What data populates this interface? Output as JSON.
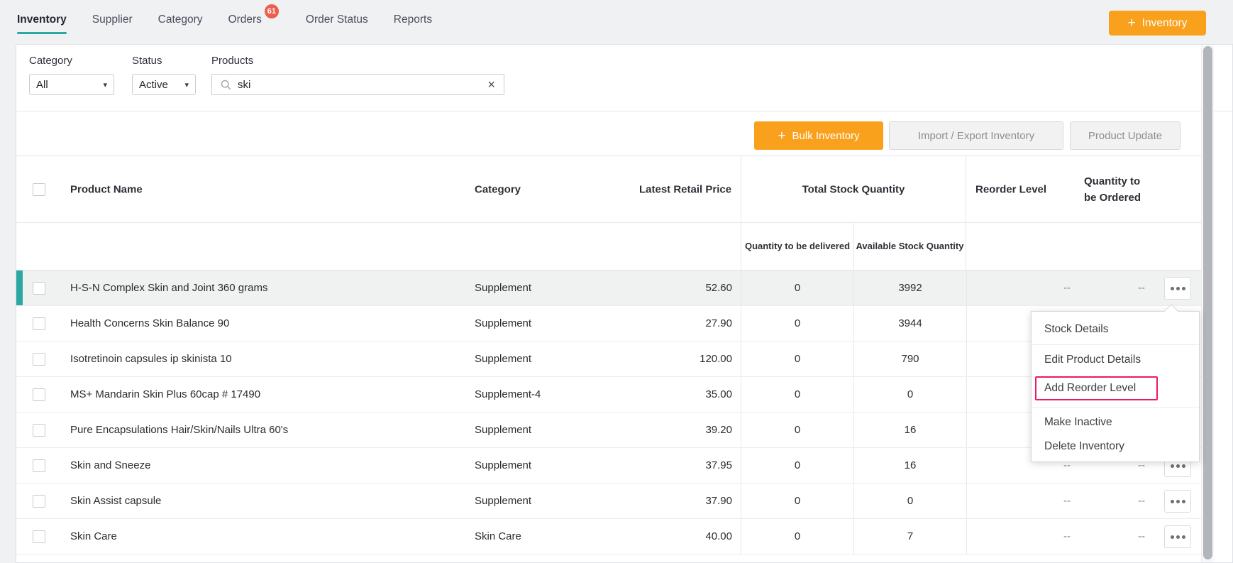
{
  "nav": {
    "tabs": [
      {
        "label": "Inventory",
        "active": true
      },
      {
        "label": "Supplier"
      },
      {
        "label": "Category"
      },
      {
        "label": "Orders",
        "badge": "61"
      },
      {
        "label": "Order Status"
      },
      {
        "label": "Reports"
      }
    ],
    "add_button": {
      "icon": "+",
      "label": "Inventory"
    }
  },
  "filters": {
    "category": {
      "label": "Category",
      "value": "All"
    },
    "status": {
      "label": "Status",
      "value": "Active"
    },
    "products": {
      "label": "Products",
      "value": "ski"
    },
    "clear_icon": "×"
  },
  "toolbar": {
    "bulk_button": {
      "icon": "+",
      "label": "Bulk Inventory"
    },
    "import_export_label": "Import / Export Inventory",
    "product_update_label": "Product Update"
  },
  "table": {
    "headers": {
      "product_name": "Product Name",
      "category": "Category",
      "latest_retail_price": "Latest Retail Price",
      "total_stock_quantity": "Total Stock Quantity",
      "quantity_to_be_delivered": "Quantity to be delivered",
      "available_stock_quantity": "Available Stock Quantity",
      "reorder_level": "Reorder Level",
      "quantity_to_be_ordered": "Quantity to be Ordered"
    },
    "rows": [
      {
        "name": "H-S-N Complex Skin and Joint 360 grams",
        "category": "Supplement",
        "price": "52.60",
        "to_deliver": "0",
        "available": "3992",
        "reorder": "--",
        "to_order": "--",
        "highlighted": true,
        "actions": true
      },
      {
        "name": "Health Concerns Skin Balance 90",
        "category": "Supplement",
        "price": "27.90",
        "to_deliver": "0",
        "available": "3944",
        "reorder": "",
        "to_order": "",
        "actions": false
      },
      {
        "name": "Isotretinoin capsules ip skinista 10",
        "category": "Supplement",
        "price": "120.00",
        "to_deliver": "0",
        "available": "790",
        "reorder": "",
        "to_order": "",
        "actions": false
      },
      {
        "name": "MS+ Mandarin Skin Plus 60cap # 17490",
        "category": "Supplement-4",
        "price": "35.00",
        "to_deliver": "0",
        "available": "0",
        "reorder": "",
        "to_order": "",
        "actions": false
      },
      {
        "name": "Pure Encapsulations Hair/Skin/Nails Ultra 60's",
        "category": "Supplement",
        "price": "39.20",
        "to_deliver": "0",
        "available": "16",
        "reorder": "",
        "to_order": "",
        "actions": false
      },
      {
        "name": "Skin and Sneeze",
        "category": "Supplement",
        "price": "37.95",
        "to_deliver": "0",
        "available": "16",
        "reorder": "--",
        "to_order": "--",
        "actions": true
      },
      {
        "name": "Skin Assist capsule",
        "category": "Supplement",
        "price": "37.90",
        "to_deliver": "0",
        "available": "0",
        "reorder": "--",
        "to_order": "--",
        "actions": true
      },
      {
        "name": "Skin Care",
        "category": "Skin Care",
        "price": "40.00",
        "to_deliver": "0",
        "available": "7",
        "reorder": "--",
        "to_order": "--",
        "actions": true
      }
    ]
  },
  "menu": {
    "items": [
      {
        "label": "Stock Details",
        "divider_after": true
      },
      {
        "label": "Edit Product Details"
      },
      {
        "label": "Add Reorder Level",
        "highlighted": true,
        "divider_after": true
      },
      {
        "label": "Make Inactive"
      },
      {
        "label": "Delete Inventory"
      }
    ]
  },
  "colors": {
    "accent_orange": "#f9a11c",
    "teal": "#2aa8a1",
    "highlight_crimson": "#ed1a5e",
    "badge_red": "#ef5d4b"
  }
}
